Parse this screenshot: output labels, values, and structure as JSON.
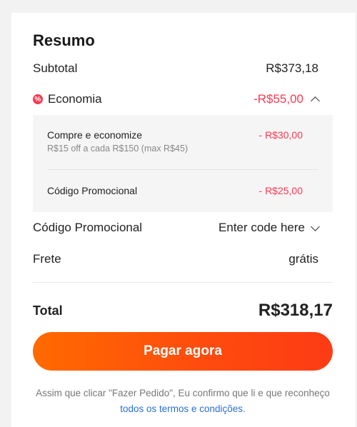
{
  "summary": {
    "title": "Resumo",
    "subtotal_label": "Subtotal",
    "subtotal_value": "R$373,18",
    "economy_icon": "discount-badge-icon",
    "economy_label": "Economia",
    "economy_value": "-R$55,00",
    "breakdown": [
      {
        "label": "Compre e economize",
        "detail": "R$15 off a cada R$150 (max R$45)",
        "amount": "- R$30,00"
      },
      {
        "label": "Código Promocional",
        "detail": "",
        "amount": "- R$25,00"
      }
    ],
    "promo_label": "Código Promocional",
    "promo_placeholder": "Enter code here",
    "shipping_label": "Frete",
    "shipping_value": "grátis",
    "total_label": "Total",
    "total_value": "R$318,17",
    "pay_button": "Pagar agora",
    "legal_text": "Assim que clicar \"Fazer Pedido\", Eu confirmo que li e que reconheço",
    "legal_link": "todos os termos e condições."
  },
  "colors": {
    "accent_red": "#fd384f",
    "button_start": "#ff6a00",
    "button_end": "#fd3b14",
    "link": "#2a6fd6"
  }
}
